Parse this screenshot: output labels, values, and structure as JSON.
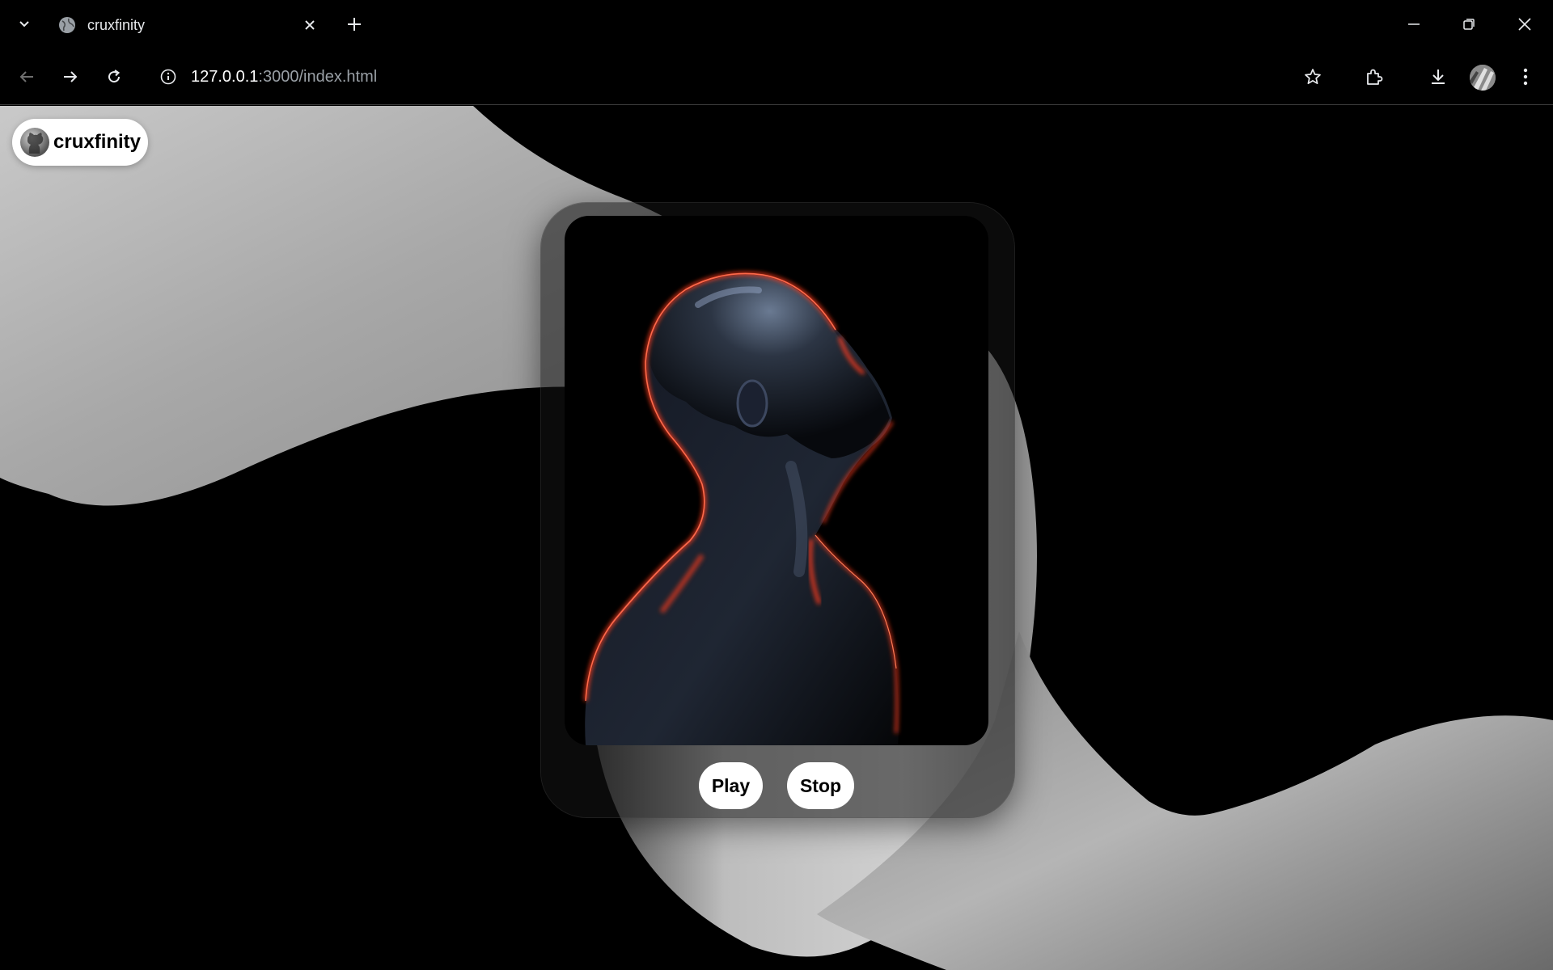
{
  "browser": {
    "tab_title": "cruxfinity",
    "url_host": "127.0.0.1",
    "url_rest": ":3000/index.html",
    "icons": [
      "tab-list-icon",
      "globe-icon",
      "close-icon",
      "plus-icon",
      "minimize-icon",
      "restore-icon",
      "window-close-icon",
      "back-icon",
      "forward-icon",
      "reload-icon",
      "site-info-icon",
      "star-icon",
      "extensions-icon",
      "download-icon",
      "menu-icon"
    ]
  },
  "page": {
    "brand_name": "cruxfinity",
    "controls": {
      "play_label": "Play",
      "stop_label": "Stop"
    },
    "colors": {
      "background": "#000000",
      "ribbon": "#bdbdbd",
      "rim_glow": "#ff3b1f"
    }
  }
}
